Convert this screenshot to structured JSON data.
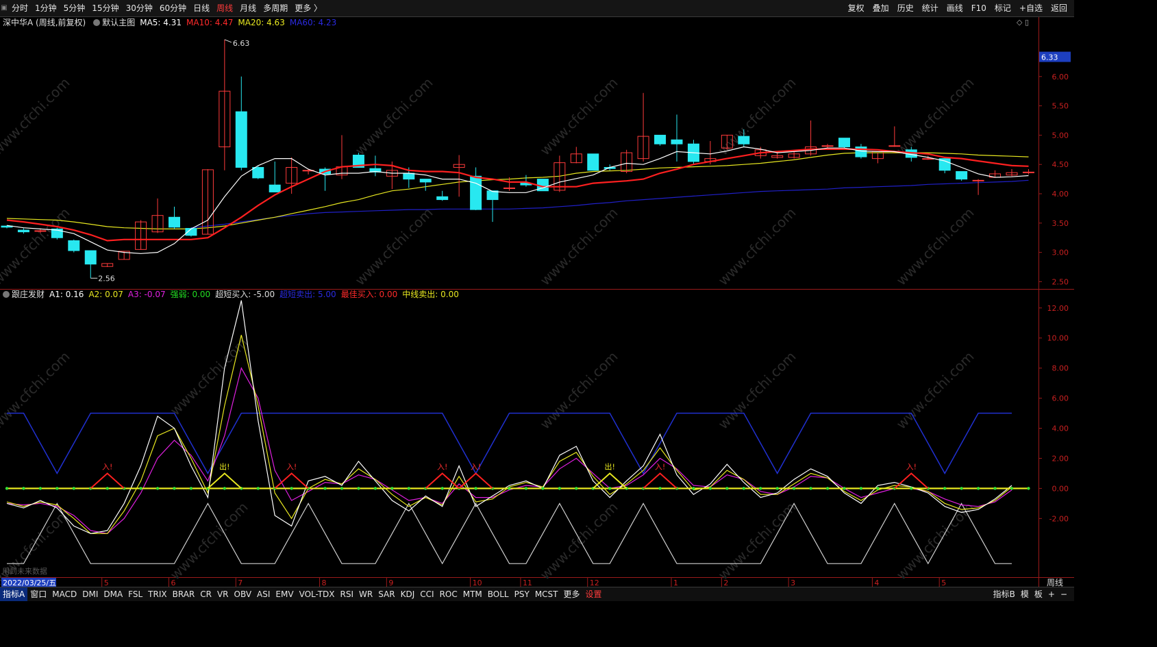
{
  "toolbar": {
    "tabs": [
      "分时",
      "1分钟",
      "5分钟",
      "15分钟",
      "30分钟",
      "60分钟",
      "日线",
      "周线",
      "月线",
      "多周期",
      "更多 〉"
    ],
    "active": "周线",
    "right_buttons": [
      "复权",
      "叠加",
      "历史",
      "统计",
      "画线",
      "F10",
      "标记",
      "+自选",
      "返回"
    ]
  },
  "main_info": {
    "title": "深中华A (周线,前复权)",
    "indicator": "默认主图",
    "ma5": "MA5: 4.31",
    "ma10": "MA10: 4.47",
    "ma20": "MA20: 4.63",
    "ma60": "MA60: 4.23"
  },
  "sub_info": {
    "name": "跟庄发财",
    "a1": "A1: 0.16",
    "a2": "A2: 0.07",
    "a3": "A3: -0.07",
    "strong": "强弱: 0.00",
    "ultra_buy": "超短买入: -5.00",
    "ultra_sell": "超短卖出: 5.00",
    "best_buy": "最佳买入: 0.00",
    "mid_sell": "中线卖出: 0.00"
  },
  "colors": {
    "up": "#ff3b3b",
    "down": "#28e8f0",
    "ma5": "#ffffff",
    "ma10": "#ff2020",
    "ma20": "#e8e820",
    "ma60": "#2020c8",
    "bg": "#000000",
    "axis": "#9a1a1a"
  },
  "chart_data": {
    "type": "candlestick",
    "period": "weekly",
    "price_axis": {
      "ticks": [
        2.5,
        3.0,
        3.5,
        4.0,
        4.5,
        5.0,
        5.5,
        6.0
      ],
      "ylim": [
        2.4,
        6.85
      ]
    },
    "last_price_tag": "6.33",
    "max_label": "6.63",
    "min_label": "2.56",
    "candles": [
      [
        3.45,
        3.46,
        3.41,
        3.43
      ],
      [
        3.38,
        3.41,
        3.32,
        3.35
      ],
      [
        3.36,
        3.41,
        3.33,
        3.37
      ],
      [
        3.4,
        3.42,
        3.22,
        3.25
      ],
      [
        3.2,
        3.22,
        3.0,
        3.03
      ],
      [
        3.03,
        3.03,
        2.56,
        2.8
      ],
      [
        2.76,
        2.81,
        2.75,
        2.81
      ],
      [
        2.88,
        3.02,
        2.88,
        3.02
      ],
      [
        3.05,
        3.55,
        3.05,
        3.52
      ],
      [
        3.35,
        3.92,
        3.33,
        3.63
      ],
      [
        3.6,
        3.78,
        3.4,
        3.43
      ],
      [
        3.41,
        3.42,
        3.27,
        3.29
      ],
      [
        3.31,
        4.42,
        3.31,
        4.41
      ],
      [
        4.8,
        6.63,
        4.4,
        5.75
      ],
      [
        5.4,
        6.0,
        4.4,
        4.45
      ],
      [
        4.45,
        4.48,
        4.25,
        4.27
      ],
      [
        4.15,
        4.55,
        4.05,
        4.03
      ],
      [
        4.18,
        4.62,
        4.0,
        4.45
      ],
      [
        4.4,
        4.42,
        4.33,
        4.4
      ],
      [
        4.42,
        4.45,
        4.05,
        4.34
      ],
      [
        4.32,
        5.0,
        4.25,
        4.46
      ],
      [
        4.66,
        4.7,
        4.48,
        4.45
      ],
      [
        4.43,
        4.65,
        4.3,
        4.37
      ],
      [
        4.3,
        4.55,
        4.08,
        4.4
      ],
      [
        4.35,
        4.45,
        4.1,
        4.25
      ],
      [
        4.25,
        4.25,
        4.05,
        4.2
      ],
      [
        3.95,
        4.05,
        3.88,
        3.9
      ],
      [
        4.45,
        4.66,
        3.95,
        4.5
      ],
      [
        4.3,
        4.45,
        3.72,
        3.73
      ],
      [
        4.05,
        4.05,
        3.52,
        3.9
      ],
      [
        4.1,
        4.28,
        4.05,
        4.1
      ],
      [
        4.18,
        4.32,
        4.12,
        4.15
      ],
      [
        4.25,
        4.25,
        4.08,
        4.05
      ],
      [
        4.06,
        4.65,
        4.03,
        4.53
      ],
      [
        4.53,
        4.8,
        4.52,
        4.68
      ],
      [
        4.68,
        4.68,
        4.42,
        4.4
      ],
      [
        4.45,
        4.5,
        4.4,
        4.43
      ],
      [
        4.38,
        4.75,
        4.35,
        4.7
      ],
      [
        4.6,
        5.72,
        4.55,
        4.98
      ],
      [
        5.0,
        5.0,
        4.82,
        4.85
      ],
      [
        4.92,
        5.35,
        4.55,
        4.85
      ],
      [
        4.85,
        4.92,
        4.5,
        4.55
      ],
      [
        4.55,
        4.9,
        4.5,
        4.6
      ],
      [
        4.78,
        5.0,
        4.75,
        5.0
      ],
      [
        4.98,
        5.1,
        4.8,
        4.85
      ],
      [
        4.65,
        4.8,
        4.6,
        4.75
      ],
      [
        4.62,
        4.7,
        4.6,
        4.65
      ],
      [
        4.62,
        4.72,
        4.6,
        4.68
      ],
      [
        4.68,
        5.25,
        4.65,
        4.8
      ],
      [
        4.82,
        4.85,
        4.78,
        4.82
      ],
      [
        4.95,
        4.95,
        4.78,
        4.8
      ],
      [
        4.8,
        4.85,
        4.6,
        4.63
      ],
      [
        4.6,
        4.7,
        4.52,
        4.72
      ],
      [
        4.82,
        5.15,
        4.8,
        4.82
      ],
      [
        4.75,
        4.8,
        4.55,
        4.62
      ],
      [
        4.6,
        4.65,
        4.58,
        4.6
      ],
      [
        4.6,
        4.6,
        4.35,
        4.4
      ],
      [
        4.38,
        4.38,
        4.22,
        4.25
      ],
      [
        4.22,
        4.25,
        3.98,
        4.23
      ],
      [
        4.28,
        4.4,
        4.28,
        4.34
      ],
      [
        4.32,
        4.42,
        4.3,
        4.36
      ],
      [
        4.37,
        4.42,
        4.33,
        4.37
      ]
    ],
    "ma": {
      "ma5": [
        3.46,
        3.42,
        3.4,
        3.38,
        3.32,
        3.18,
        3.04,
        3.0,
        2.98,
        3.0,
        3.15,
        3.4,
        3.55,
        3.95,
        4.3,
        4.48,
        4.6,
        4.6,
        4.42,
        4.32,
        4.35,
        4.35,
        4.38,
        4.35,
        4.35,
        4.32,
        4.25,
        4.25,
        4.18,
        4.04,
        4.02,
        4.02,
        4.1,
        4.2,
        4.26,
        4.32,
        4.45,
        4.52,
        4.5,
        4.6,
        4.72,
        4.7,
        4.68,
        4.73,
        4.8,
        4.76,
        4.7,
        4.72,
        4.74,
        4.78,
        4.78,
        4.73,
        4.72,
        4.72,
        4.67,
        4.62,
        4.56,
        4.45,
        4.34,
        4.28,
        4.29,
        4.31
      ],
      "ma10": [
        3.55,
        3.52,
        3.48,
        3.44,
        3.38,
        3.3,
        3.2,
        3.22,
        3.22,
        3.22,
        3.22,
        3.22,
        3.25,
        3.42,
        3.6,
        3.8,
        3.98,
        4.12,
        4.25,
        4.38,
        4.46,
        4.48,
        4.5,
        4.48,
        4.4,
        4.38,
        4.38,
        4.36,
        4.28,
        4.25,
        4.2,
        4.2,
        4.12,
        4.12,
        4.12,
        4.18,
        4.2,
        4.22,
        4.25,
        4.35,
        4.42,
        4.5,
        4.55,
        4.6,
        4.65,
        4.7,
        4.72,
        4.74,
        4.76,
        4.76,
        4.76,
        4.76,
        4.75,
        4.72,
        4.7,
        4.68,
        4.62,
        4.6,
        4.56,
        4.52,
        4.48,
        4.47
      ],
      "ma20": [
        3.58,
        3.57,
        3.56,
        3.55,
        3.52,
        3.48,
        3.44,
        3.42,
        3.41,
        3.4,
        3.4,
        3.4,
        3.42,
        3.45,
        3.5,
        3.55,
        3.6,
        3.66,
        3.72,
        3.78,
        3.85,
        3.9,
        3.98,
        4.05,
        4.08,
        4.12,
        4.16,
        4.2,
        4.22,
        4.24,
        4.25,
        4.27,
        4.28,
        4.3,
        4.35,
        4.38,
        4.39,
        4.4,
        4.42,
        4.44,
        4.45,
        4.46,
        4.47,
        4.48,
        4.5,
        4.52,
        4.55,
        4.58,
        4.62,
        4.66,
        4.69,
        4.7,
        4.7,
        4.7,
        4.7,
        4.7,
        4.69,
        4.68,
        4.66,
        4.65,
        4.64,
        4.63
      ],
      "ma60_start": 11,
      "ma60": [
        3.42,
        3.45,
        3.48,
        3.52,
        3.56,
        3.6,
        3.63,
        3.66,
        3.68,
        3.69,
        3.7,
        3.71,
        3.72,
        3.73,
        3.73,
        3.74,
        3.74,
        3.74,
        3.74,
        3.74,
        3.75,
        3.76,
        3.78,
        3.8,
        3.83,
        3.85,
        3.88,
        3.9,
        3.92,
        3.94,
        3.96,
        3.98,
        4.0,
        4.02,
        4.04,
        4.05,
        4.06,
        4.07,
        4.08,
        4.1,
        4.11,
        4.12,
        4.13,
        4.14,
        4.16,
        4.17,
        4.18,
        4.19,
        4.2,
        4.21,
        4.23
      ]
    },
    "sub_axis": {
      "ticks": [
        -2.0,
        0.0,
        2.0,
        4.0,
        6.0,
        8.0,
        10.0,
        12.0
      ],
      "ylim": [
        -5.4,
        12.9
      ]
    },
    "sub": {
      "strong_line": [
        5,
        5,
        3,
        1,
        3,
        5,
        5,
        5,
        5,
        5,
        5,
        3,
        1,
        3,
        5,
        5,
        5,
        5,
        5,
        5,
        5,
        5,
        5,
        5,
        5,
        5,
        5,
        3,
        1,
        3,
        5,
        5,
        5,
        5,
        5,
        5,
        5,
        3,
        1,
        3,
        5,
        5,
        5,
        5,
        5,
        3,
        1,
        3,
        5,
        5,
        5,
        5,
        5,
        5,
        5,
        3,
        1,
        3,
        5,
        5,
        5
      ],
      "bottom_line": [
        -5,
        -5,
        -3,
        -1,
        -3,
        -5,
        -5,
        -5,
        -5,
        -5,
        -5,
        -3,
        -1,
        -3,
        -5,
        -5,
        -5,
        -3,
        -1,
        -3,
        -5,
        -5,
        -5,
        -3,
        -1,
        -3,
        -5,
        -3,
        -1,
        -3,
        -5,
        -5,
        -3,
        -1,
        -3,
        -5,
        -5,
        -3,
        -1,
        -3,
        -5,
        -5,
        -5,
        -5,
        -5,
        -5,
        -3,
        -1,
        -3,
        -5,
        -5,
        -5,
        -3,
        -1,
        -3,
        -5,
        -3,
        -1,
        -3,
        -5,
        -5
      ],
      "a1": [
        -1.0,
        -1.3,
        -0.8,
        -1.3,
        -2.5,
        -3.0,
        -2.8,
        -1.0,
        1.5,
        4.8,
        4.0,
        1.5,
        -0.6,
        8.0,
        12.5,
        4.5,
        -1.8,
        -2.5,
        0.5,
        0.8,
        0.2,
        1.8,
        0.5,
        -0.8,
        -1.5,
        -0.5,
        -1.2,
        1.5,
        -1.2,
        -0.5,
        0.2,
        0.5,
        0.0,
        2.2,
        2.8,
        0.5,
        -0.6,
        0.5,
        1.5,
        3.6,
        0.9,
        -0.4,
        0.3,
        1.6,
        0.4,
        -0.6,
        -0.3,
        0.6,
        1.3,
        0.8,
        -0.3,
        -1.0,
        0.2,
        0.4,
        0.1,
        -0.3,
        -1.2,
        -1.6,
        -1.4,
        -0.7,
        0.2
      ],
      "a2": [
        -0.9,
        -1.2,
        -0.9,
        -1.1,
        -2.0,
        -3.0,
        -3.0,
        -1.5,
        0.5,
        3.5,
        4.0,
        2.0,
        -0.3,
        5.5,
        10.2,
        5.5,
        -0.3,
        -2.0,
        0.0,
        0.6,
        0.3,
        1.3,
        0.6,
        -0.4,
        -1.2,
        -0.6,
        -1.1,
        0.8,
        -0.9,
        -0.7,
        0.1,
        0.4,
        0.1,
        1.8,
        2.4,
        0.8,
        -0.4,
        0.3,
        1.2,
        2.7,
        1.2,
        -0.1,
        0.1,
        1.2,
        0.6,
        -0.4,
        -0.4,
        0.3,
        1.0,
        0.7,
        -0.2,
        -0.8,
        -0.1,
        0.2,
        0.1,
        -0.2,
        -1.0,
        -1.4,
        -1.3,
        -0.8,
        0.1
      ],
      "a3": [
        -1.0,
        -1.1,
        -1.0,
        -1.2,
        -1.8,
        -2.8,
        -3.0,
        -2.0,
        -0.3,
        2.0,
        3.2,
        2.2,
        0.5,
        3.5,
        8.0,
        6.0,
        1.2,
        -0.8,
        -0.2,
        0.4,
        0.3,
        0.9,
        0.6,
        -0.1,
        -0.8,
        -0.6,
        -1.0,
        0.3,
        -0.6,
        -0.6,
        -0.1,
        0.2,
        0.1,
        1.3,
        2.0,
        1.0,
        0.0,
        0.2,
        0.9,
        2.0,
        1.3,
        0.2,
        0.1,
        0.9,
        0.6,
        -0.2,
        -0.4,
        0.1,
        0.8,
        0.7,
        0.0,
        -0.6,
        -0.3,
        0.0,
        0.0,
        -0.2,
        -0.7,
        -1.1,
        -1.2,
        -0.9,
        -0.1
      ],
      "buy_signals": [
        6,
        17,
        26,
        28,
        39,
        54
      ],
      "sell_signals": [
        13,
        36
      ],
      "buy_label": "入!",
      "sell_label": "出!"
    },
    "x_ticks": [
      {
        "i": 6,
        "label": "5"
      },
      {
        "i": 10,
        "label": "6"
      },
      {
        "i": 14,
        "label": "7"
      },
      {
        "i": 19,
        "label": "8"
      },
      {
        "i": 23,
        "label": "9"
      },
      {
        "i": 28,
        "label": "10"
      },
      {
        "i": 31,
        "label": "11"
      },
      {
        "i": 35,
        "label": "12"
      },
      {
        "i": 40,
        "label": "1"
      },
      {
        "i": 43,
        "label": "2"
      },
      {
        "i": 47,
        "label": "3"
      },
      {
        "i": 52,
        "label": "4"
      },
      {
        "i": 56,
        "label": "5"
      }
    ],
    "cursor_date": "2022/03/25/五",
    "future_data_label": "用到未来数据",
    "period_label": "周线"
  },
  "watermark": "www.cfchi.com",
  "bottombar": {
    "left": [
      "指标A",
      "窗口",
      "MACD",
      "DMI",
      "DMA",
      "FSL",
      "TRIX",
      "BRAR",
      "CR",
      "VR",
      "OBV",
      "ASI",
      "EMV",
      "VOL-TDX",
      "RSI",
      "WR",
      "SAR",
      "KDJ",
      "CCI",
      "ROC",
      "MTM",
      "BOLL",
      "PSY",
      "MCST",
      "更多",
      "设置"
    ],
    "right": [
      "指标B",
      "模",
      "板",
      "+",
      "−"
    ]
  }
}
